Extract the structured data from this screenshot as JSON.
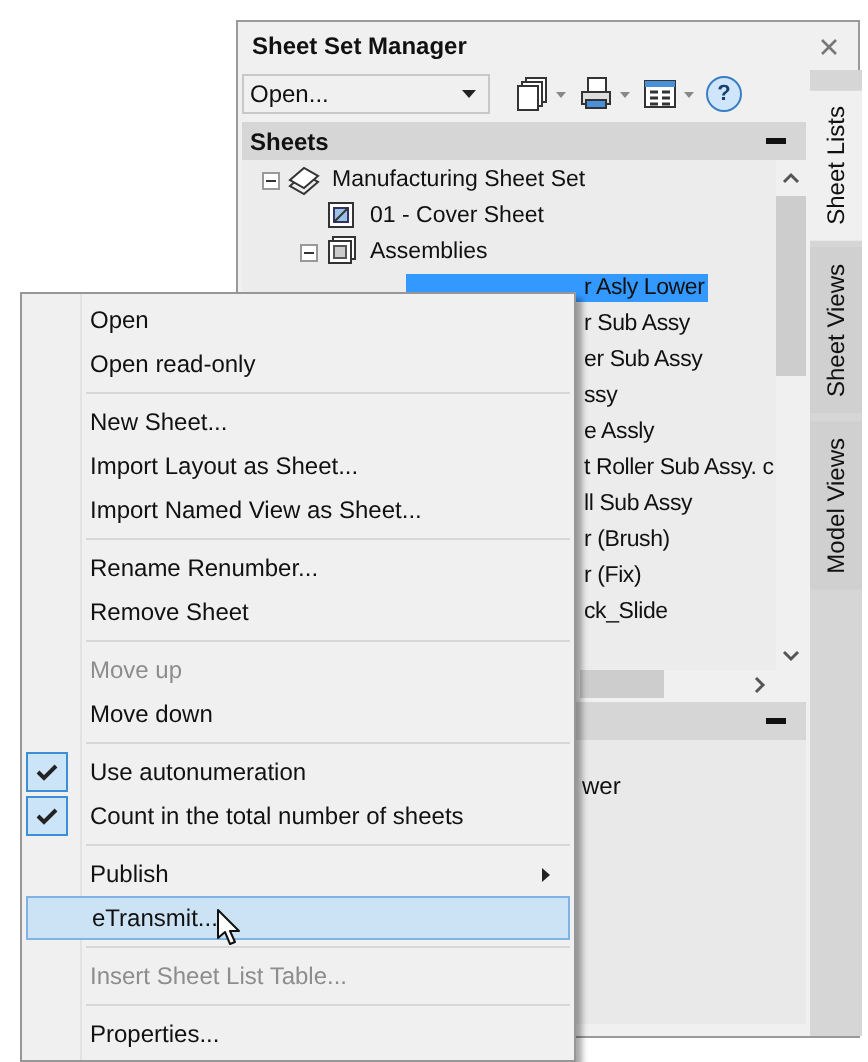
{
  "panel": {
    "title": "Sheet Set Manager",
    "toolbar": {
      "dropdown": {
        "value": "Open..."
      },
      "help_button": "?"
    },
    "sheets_section": {
      "title": "Sheets",
      "tree": [
        {
          "label": "Manufacturing Sheet Set",
          "kind": "set",
          "expanded": true,
          "selected": false,
          "children": [
            {
              "label": "01 - Cover Sheet",
              "kind": "sheet",
              "selected": false
            },
            {
              "label": "Assemblies",
              "kind": "subset",
              "expanded": true,
              "selected": false,
              "children": [
                {
                  "label": "r Asly Lower",
                  "covered": true,
                  "selected": true
                },
                {
                  "label": "r Sub Assy",
                  "covered": true,
                  "selected": false
                },
                {
                  "label": "er Sub Assy",
                  "covered": true,
                  "selected": false
                },
                {
                  "label": "ssy",
                  "covered": true,
                  "selected": false
                },
                {
                  "label": "e Assly",
                  "covered": true,
                  "selected": false
                },
                {
                  "label": "t Roller Sub Assy. c",
                  "covered": true,
                  "selected": false
                },
                {
                  "label": "ll Sub Assy",
                  "covered": true,
                  "selected": false
                },
                {
                  "label": "r (Brush)",
                  "covered": true,
                  "selected": false
                },
                {
                  "label": "r (Fix)",
                  "covered": true,
                  "selected": false
                },
                {
                  "label": "ck_Slide",
                  "covered": true,
                  "selected": false
                }
              ]
            }
          ]
        }
      ]
    },
    "details_section": {
      "lines": [
        "wer"
      ]
    },
    "tabs": [
      {
        "label": "Sheet Lists",
        "selected": true
      },
      {
        "label": "Sheet Views",
        "selected": false
      },
      {
        "label": "Model Views",
        "selected": false
      }
    ]
  },
  "context_menu": {
    "groups": [
      [
        {
          "label": "Open",
          "disabled": false,
          "checked": false,
          "selected": false,
          "submenu": false
        },
        {
          "label": "Open read-only",
          "disabled": false,
          "checked": false,
          "selected": false,
          "submenu": false
        }
      ],
      [
        {
          "label": "New Sheet...",
          "disabled": false,
          "checked": false,
          "selected": false,
          "submenu": false
        },
        {
          "label": "Import Layout as Sheet...",
          "disabled": false,
          "checked": false,
          "selected": false,
          "submenu": false
        },
        {
          "label": "Import Named View as Sheet...",
          "disabled": false,
          "checked": false,
          "selected": false,
          "submenu": false
        }
      ],
      [
        {
          "label": "Rename  Renumber...",
          "disabled": false,
          "checked": false,
          "selected": false,
          "submenu": false
        },
        {
          "label": "Remove Sheet",
          "disabled": false,
          "checked": false,
          "selected": false,
          "submenu": false
        }
      ],
      [
        {
          "label": "Move up",
          "disabled": true,
          "checked": false,
          "selected": false,
          "submenu": false
        },
        {
          "label": "Move down",
          "disabled": false,
          "checked": false,
          "selected": false,
          "submenu": false
        }
      ],
      [
        {
          "label": "Use autonumeration",
          "disabled": false,
          "checked": true,
          "selected": false,
          "submenu": false
        },
        {
          "label": "Count in the total number of sheets",
          "disabled": false,
          "checked": true,
          "selected": false,
          "submenu": false
        }
      ],
      [
        {
          "label": "Publish",
          "disabled": false,
          "checked": false,
          "selected": false,
          "submenu": true
        },
        {
          "label": "eTransmit...",
          "disabled": false,
          "checked": false,
          "selected": true,
          "submenu": false
        }
      ],
      [
        {
          "label": "Insert Sheet List Table...",
          "disabled": true,
          "checked": false,
          "selected": false,
          "submenu": false
        }
      ],
      [
        {
          "label": "Properties...",
          "disabled": false,
          "checked": false,
          "selected": false,
          "submenu": false
        }
      ]
    ]
  }
}
